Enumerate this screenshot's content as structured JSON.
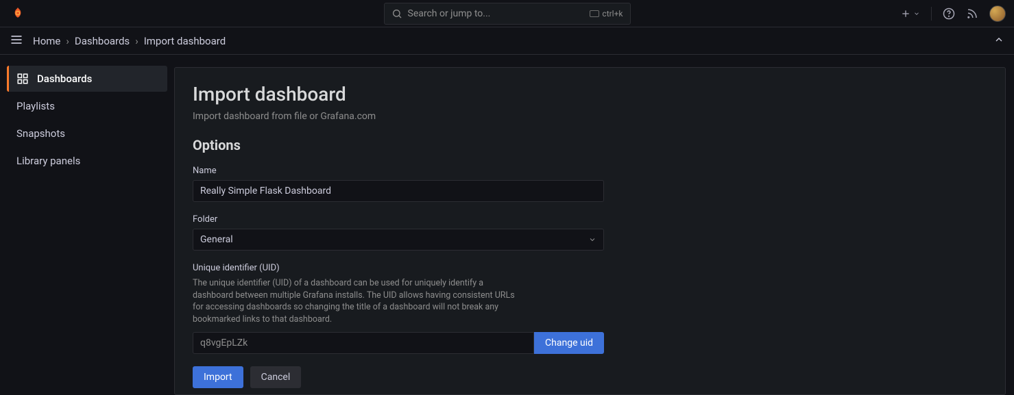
{
  "topbar": {
    "search_placeholder": "Search or jump to...",
    "search_shortcut": "ctrl+k"
  },
  "breadcrumb": {
    "items": [
      "Home",
      "Dashboards",
      "Import dashboard"
    ]
  },
  "sidebar": {
    "items": [
      {
        "label": "Dashboards",
        "active": true
      },
      {
        "label": "Playlists",
        "active": false
      },
      {
        "label": "Snapshots",
        "active": false
      },
      {
        "label": "Library panels",
        "active": false
      }
    ]
  },
  "page": {
    "title": "Import dashboard",
    "subtitle": "Import dashboard from file or Grafana.com",
    "section": "Options"
  },
  "form": {
    "name_label": "Name",
    "name_value": "Really Simple Flask Dashboard",
    "folder_label": "Folder",
    "folder_value": "General",
    "uid_label": "Unique identifier (UID)",
    "uid_help": "The unique identifier (UID) of a dashboard can be used for uniquely identify a dashboard between multiple Grafana installs. The UID allows having consistent URLs for accessing dashboards so changing the title of a dashboard will not break any bookmarked links to that dashboard.",
    "uid_value": "q8vgEpLZk",
    "change_uid_label": "Change uid",
    "import_label": "Import",
    "cancel_label": "Cancel"
  }
}
